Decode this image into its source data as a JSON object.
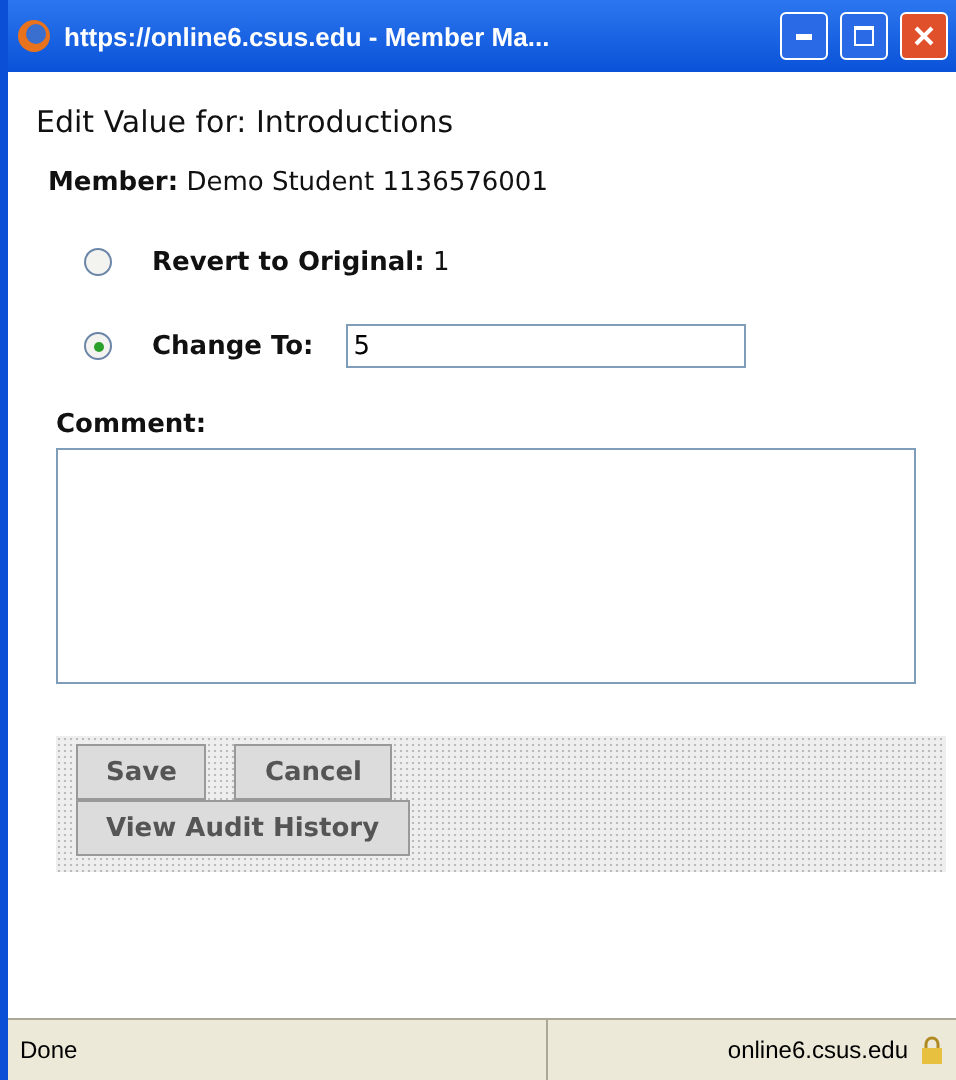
{
  "window": {
    "title": "https://online6.csus.edu - Member Ma..."
  },
  "heading": "Edit Value for: Introductions",
  "member": {
    "label": "Member:",
    "value": "Demo Student 1136576001"
  },
  "options": [
    {
      "label": "Revert to Original:",
      "value": "1",
      "kind": "text",
      "selected": false
    },
    {
      "label": "Change To:",
      "value": "5",
      "kind": "input",
      "selected": true
    }
  ],
  "comment": {
    "label": "Comment:"
  },
  "buttons": [
    "Save",
    "Cancel",
    "View Audit History"
  ],
  "status_bar": {
    "text": "Done",
    "host": "online6.csus.edu"
  }
}
